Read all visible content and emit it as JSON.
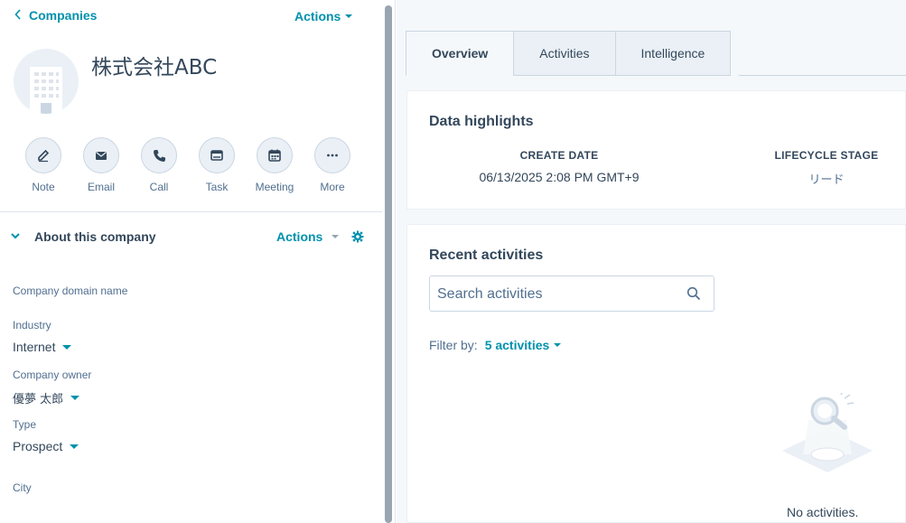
{
  "header": {
    "back_label": "Companies",
    "actions_label": "Actions"
  },
  "company": {
    "name": "株式会社ABC"
  },
  "quick_actions": [
    {
      "label": "Note",
      "icon": "edit-icon"
    },
    {
      "label": "Email",
      "icon": "email-icon"
    },
    {
      "label": "Call",
      "icon": "phone-icon"
    },
    {
      "label": "Task",
      "icon": "task-icon"
    },
    {
      "label": "Meeting",
      "icon": "calendar-icon"
    },
    {
      "label": "More",
      "icon": "more-icon"
    }
  ],
  "about": {
    "title": "About this company",
    "actions_label": "Actions",
    "properties": [
      {
        "label": "Company domain name",
        "value": ""
      },
      {
        "label": "Industry",
        "value": "Internet"
      },
      {
        "label": "Company owner",
        "value": "優夢 太郎"
      },
      {
        "label": "Type",
        "value": "Prospect"
      },
      {
        "label": "City",
        "value": ""
      }
    ]
  },
  "tabs": [
    {
      "label": "Overview",
      "active": true
    },
    {
      "label": "Activities",
      "active": false
    },
    {
      "label": "Intelligence",
      "active": false
    }
  ],
  "highlights": {
    "title": "Data highlights",
    "create_date_label": "CREATE DATE",
    "create_date_value": "06/13/2025 2:08 PM GMT+9",
    "lifecycle_label": "LIFECYCLE STAGE",
    "lifecycle_value": "リード"
  },
  "recent": {
    "title": "Recent activities",
    "search_placeholder": "Search activities",
    "filter_label": "Filter by:",
    "filter_value": "5 activities",
    "empty_text": "No activities."
  },
  "colors": {
    "accent": "#0091ae",
    "text": "#33475b",
    "muted": "#516f90",
    "surface": "#eaf0f6",
    "border": "#cbd6e2"
  }
}
